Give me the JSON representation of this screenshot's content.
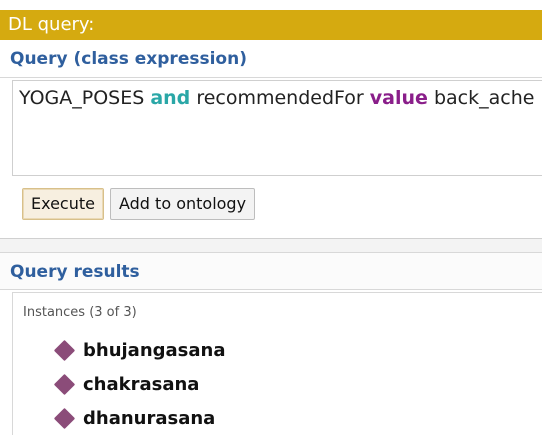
{
  "panel": {
    "title": "DL query:"
  },
  "query": {
    "header": "Query (class expression)",
    "expression": {
      "part1": "YOGA_POSES ",
      "keyword_and": "and",
      "part2": " recommendedFor ",
      "keyword_value": "value",
      "part3": " back_ache"
    },
    "execute_label": "Execute",
    "add_label": "Add to ontology"
  },
  "results": {
    "header": "Query results",
    "instances_label": "Instances (3 of 3)",
    "items": [
      {
        "name": "bhujangasana",
        "icon": "diamond-icon"
      },
      {
        "name": "chakrasana",
        "icon": "diamond-icon"
      },
      {
        "name": "dhanurasana",
        "icon": "diamond-icon"
      }
    ]
  },
  "colors": {
    "title_bar": "#d5aa10",
    "header_text": "#2f5f9e",
    "keyword_and": "#2aa7a7",
    "keyword_value": "#8a1e8a",
    "individual_icon": "#8b4c79"
  }
}
